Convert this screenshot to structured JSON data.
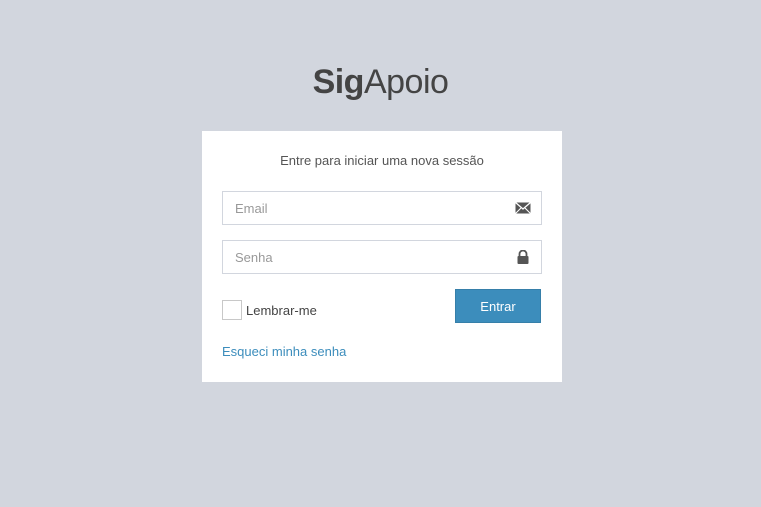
{
  "logo": {
    "bold": "Sig",
    "light": "Apoio"
  },
  "login": {
    "message": "Entre para iniciar uma nova sessão",
    "email_placeholder": "Email",
    "email_value": "",
    "email_icon": "envelope-icon",
    "password_placeholder": "Senha",
    "password_value": "",
    "password_icon": "lock-icon",
    "remember_label": "Lembrar-me",
    "remember_checked": false,
    "submit_label": "Entrar",
    "forgot_label": "Esqueci minha senha"
  },
  "colors": {
    "background": "#d2d6de",
    "accent": "#3c8dbc",
    "box": "#ffffff"
  }
}
